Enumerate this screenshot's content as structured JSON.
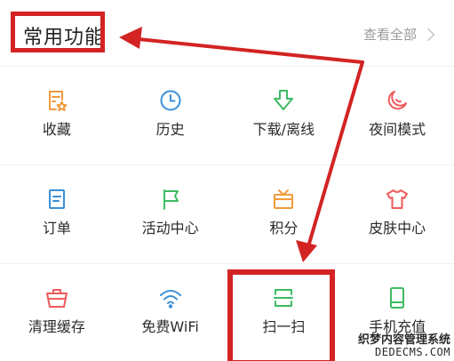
{
  "header": {
    "title": "常用功能",
    "view_all": "查看全部"
  },
  "rows": [
    [
      {
        "label": "收藏",
        "icon": "star-note-icon",
        "color": "#f29a3b"
      },
      {
        "label": "历史",
        "icon": "clock-icon",
        "color": "#3b8fd6"
      },
      {
        "label": "下载/离线",
        "icon": "download-arrow-icon",
        "color": "#3dbb63"
      },
      {
        "label": "夜间模式",
        "icon": "moon-icon",
        "color": "#ef5b5b"
      }
    ],
    [
      {
        "label": "订单",
        "icon": "order-doc-icon",
        "color": "#3b8fd6"
      },
      {
        "label": "活动中心",
        "icon": "flag-icon",
        "color": "#3dbb63"
      },
      {
        "label": "积分",
        "icon": "tv-points-icon",
        "color": "#f29a3b"
      },
      {
        "label": "皮肤中心",
        "icon": "tshirt-icon",
        "color": "#ef5b5b"
      }
    ],
    [
      {
        "label": "清理缓存",
        "icon": "basket-icon",
        "color": "#ef5b5b"
      },
      {
        "label": "免费WiFi",
        "icon": "wifi-icon",
        "color": "#3b8fd6"
      },
      {
        "label": "扫一扫",
        "icon": "scan-icon",
        "color": "#3dbb63"
      },
      {
        "label": "手机充值",
        "icon": "phone-icon",
        "color": "#3dbb63"
      }
    ]
  ],
  "annotation": {
    "color": "#d32323"
  },
  "watermark": {
    "line1": "织梦内容管理系统",
    "line2": "DEDECMS.COM"
  }
}
